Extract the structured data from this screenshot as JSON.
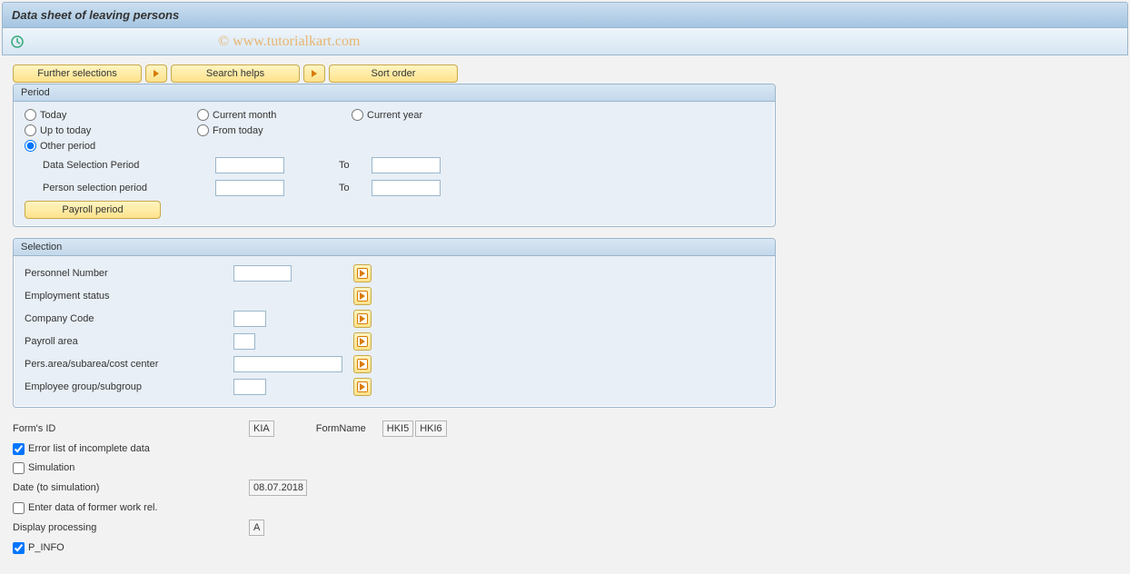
{
  "header": {
    "title": "Data sheet of leaving persons"
  },
  "watermark": "© www.tutorialkart.com",
  "toolbar_buttons": {
    "further_selections": "Further selections",
    "search_helps": "Search helps",
    "sort_order": "Sort order"
  },
  "period": {
    "group_label": "Period",
    "today": "Today",
    "current_month": "Current month",
    "current_year": "Current year",
    "up_to_today": "Up to today",
    "from_today": "From today",
    "other_period": "Other period",
    "data_selection_period": "Data Selection Period",
    "person_selection_period": "Person selection period",
    "to": "To",
    "payroll_period": "Payroll period"
  },
  "selection": {
    "group_label": "Selection",
    "personnel_number": "Personnel Number",
    "employment_status": "Employment status",
    "company_code": "Company Code",
    "payroll_area": "Payroll area",
    "pers_area": "Pers.area/subarea/cost center",
    "employee_group": "Employee group/subgroup"
  },
  "form": {
    "forms_id_label": "Form's ID",
    "forms_id_value": "KIA",
    "form_name_label": "FormName",
    "form_name_value1": "HKI5",
    "form_name_value2": "HKI6",
    "error_list": "Error list of incomplete data",
    "simulation": "Simulation",
    "date_sim_label": "Date (to simulation)",
    "date_sim_value": "08.07.2018",
    "enter_former": "Enter data of former work rel.",
    "display_processing_label": "Display processing",
    "display_processing_value": "A",
    "p_info": "P_INFO"
  }
}
